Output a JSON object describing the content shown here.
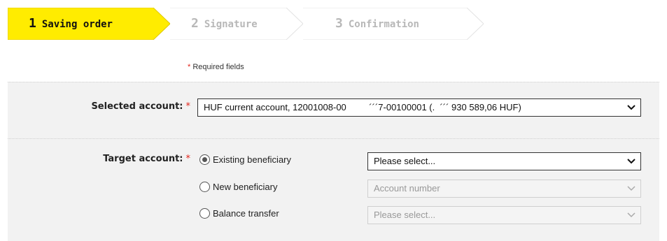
{
  "steps": [
    {
      "num": "1",
      "label": "Saving order",
      "state": "active"
    },
    {
      "num": "2",
      "label": "Signature",
      "state": "inactive"
    },
    {
      "num": "3",
      "label": "Confirmation",
      "state": "inactive"
    }
  ],
  "colors": {
    "active_step": "#ffec00",
    "required": "#e2231a"
  },
  "required_note": {
    "asterisk": "*",
    "text": "Required fields"
  },
  "selected_account": {
    "label": "Selected account:",
    "asterisk": "*",
    "value": "HUF current account, 12001008-00         ´´´7-00100001 (.  ´´´ 930 589,06 HUF)"
  },
  "target_account": {
    "label": "Target account:",
    "asterisk": "*",
    "options": [
      {
        "label": "Existing beneficiary",
        "checked": true,
        "select_value": "Please select...",
        "select_disabled": false
      },
      {
        "label": "New beneficiary",
        "checked": false,
        "select_value": "Account number",
        "select_disabled": true
      },
      {
        "label": "Balance transfer",
        "checked": false,
        "select_value": "Please select...",
        "select_disabled": true
      }
    ]
  }
}
